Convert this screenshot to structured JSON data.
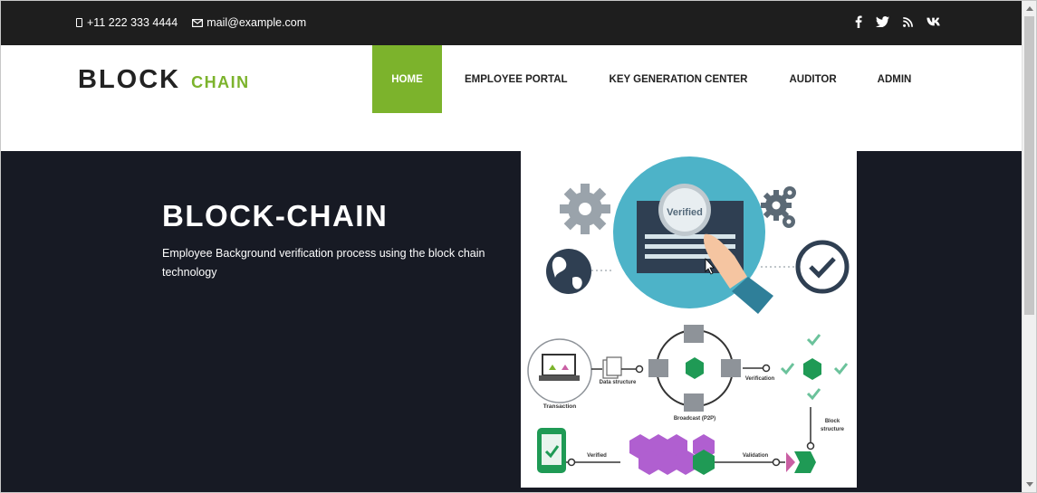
{
  "topbar": {
    "phone": "+11 222 333 4444",
    "email": "mail@example.com",
    "social": [
      "facebook-icon",
      "twitter-icon",
      "rss-icon",
      "vk-icon"
    ]
  },
  "brand": {
    "main": "BLOCK",
    "sub": "CHAIN"
  },
  "nav": {
    "items": [
      "HOME",
      "EMPLOYEE PORTAL",
      "KEY GENERATION CENTER",
      "AUDITOR",
      "ADMIN"
    ],
    "active": "HOME"
  },
  "hero": {
    "title": "BLOCK-CHAIN",
    "text": "Employee Background verification process using the block chain technology"
  },
  "illustration": {
    "verified": "Verified",
    "data_structure": "Data structure",
    "transaction": "Transaction",
    "broadcast": "Broadcast (P2P)",
    "verification": "Verification",
    "block_structure_1": "Block",
    "block_structure_2": "structure",
    "verified_small": "Verified",
    "validation": "Validation"
  },
  "colors": {
    "accent": "#7cb32c",
    "topbar": "#1e1e1e",
    "hero_bg": "#171a24",
    "teal": "#4db3c8"
  }
}
